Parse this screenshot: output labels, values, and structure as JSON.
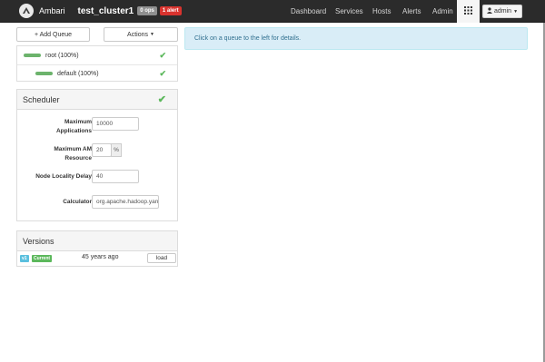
{
  "nav": {
    "brand": "Ambari",
    "cluster": "test_cluster1",
    "ops_badge": "0 ops",
    "alert_badge": "1 alert",
    "links": [
      "Dashboard",
      "Services",
      "Hosts",
      "Alerts",
      "Admin"
    ],
    "user": "admin"
  },
  "toolbar": {
    "add_queue": "+ Add Queue",
    "actions": "Actions"
  },
  "queues": [
    {
      "label": "root (100%)",
      "status": "ok"
    },
    {
      "label": "default (100%)",
      "status": "ok"
    }
  ],
  "scheduler": {
    "title": "Scheduler",
    "fields": [
      {
        "label": "Maximum Applications",
        "value": "10000"
      },
      {
        "label": "Maximum AM Resource",
        "value": "20",
        "unit": "%"
      },
      {
        "label": "Node Locality Delay",
        "value": "40"
      },
      {
        "label": "Calculator",
        "value": "org.apache.hadoop.yarn"
      }
    ]
  },
  "versions": {
    "title": "Versions",
    "tag_version": "v1",
    "tag_current": "Current",
    "age": "45 years ago",
    "load_label": "load"
  },
  "info": {
    "message": "Click on a queue to the left for details."
  },
  "colors": {
    "navbar": "#2b2b2b",
    "alert_badge": "#d9332e",
    "queue_bar": "#6cb36c",
    "check": "#5cb85c",
    "info_bg": "#d9edf7",
    "tag_version": "#5bc0de",
    "tag_current": "#5cb85c"
  }
}
